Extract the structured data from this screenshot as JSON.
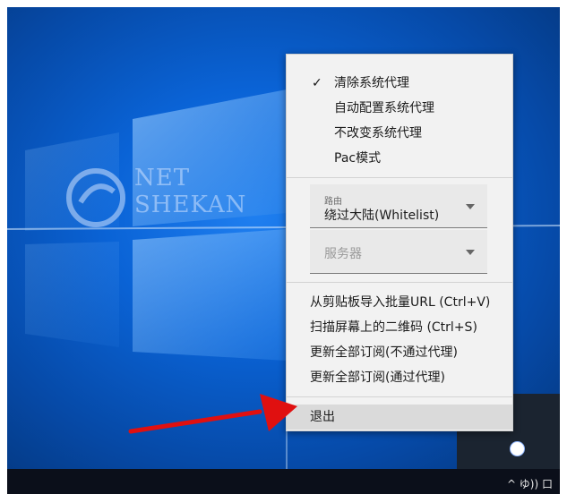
{
  "watermark": {
    "line1": "NET",
    "line2": "SHEKAN"
  },
  "menu": {
    "mode_items": [
      {
        "label": "清除系统代理",
        "checked": true
      },
      {
        "label": "自动配置系统代理",
        "checked": false
      },
      {
        "label": "不改变系统代理",
        "checked": false
      },
      {
        "label": "Pac模式",
        "checked": false
      }
    ],
    "route": {
      "caption": "路由",
      "value": "绕过大陆(Whitelist)"
    },
    "server": {
      "placeholder": "服务器"
    },
    "actions": [
      {
        "label": "从剪贴板导入批量URL (Ctrl+V)"
      },
      {
        "label": "扫描屏幕上的二维码 (Ctrl+S)"
      },
      {
        "label": "更新全部订阅(不通过代理)"
      },
      {
        "label": "更新全部订阅(通过代理)"
      }
    ],
    "exit_label": "退出"
  },
  "tray": {
    "text": "^ ゆ)) 口"
  },
  "colors": {
    "desktop_blue": "#0a63d6",
    "annotation_arrow": "#e01010"
  }
}
